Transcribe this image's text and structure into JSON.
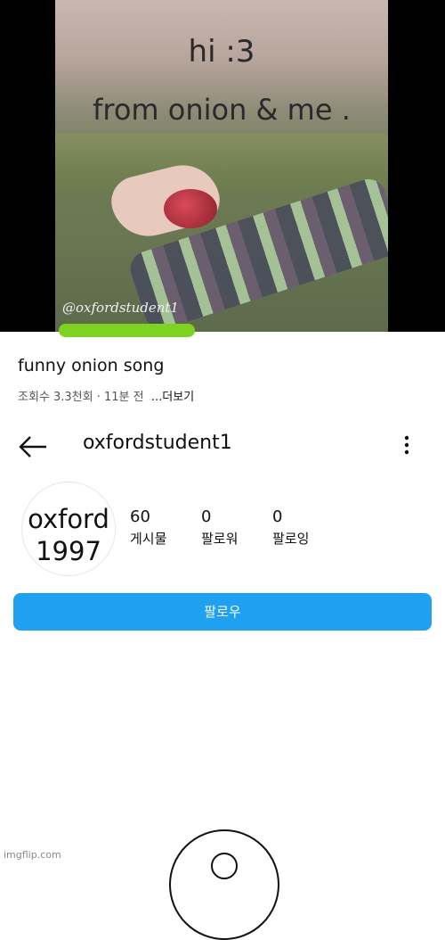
{
  "video": {
    "line1": "hi :3",
    "line2": "from onion & me .",
    "watermark": "@oxfordstudent1"
  },
  "post": {
    "title": "funny onion song",
    "meta": "조회수 3.3천회 · 11분 전",
    "more_label": "...더보기"
  },
  "profile": {
    "username": "oxfordstudent1",
    "avatar_line1": "oxford",
    "avatar_line2": "1997",
    "stats": {
      "posts_count": "60",
      "posts_label": "게시물",
      "followers_count": "0",
      "followers_label": "팔로워",
      "following_count": "0",
      "following_label": "팔로잉"
    },
    "follow_button": "팔로우"
  },
  "footer": {
    "watermark": "imgflip.com"
  },
  "colors": {
    "accent": "#1fa1f2",
    "highlight": "#7ed321"
  },
  "icons": [
    "back-arrow-icon",
    "more-vertical-icon"
  ]
}
